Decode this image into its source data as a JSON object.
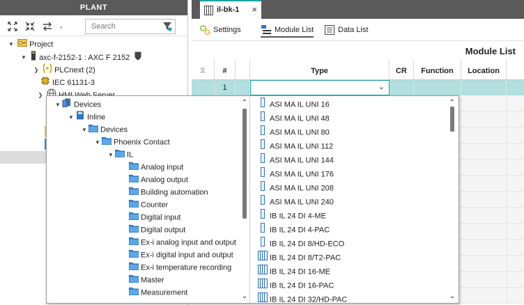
{
  "plant": {
    "header": "PLANT",
    "search_placeholder": "Search",
    "tree": [
      {
        "label": "Project"
      },
      {
        "label": "axc-f-2152-1 : AXC F 2152"
      },
      {
        "label": "PLCnext (2)"
      },
      {
        "label": "IEC 61131-3"
      },
      {
        "label": "HMI Web Server"
      }
    ]
  },
  "editor": {
    "doc_tab": "il-bk-1",
    "subtabs": [
      "Settings",
      "Module List",
      "Data List"
    ],
    "title": "Module List",
    "columns": [
      "#",
      "",
      "Type",
      "CR",
      "Function",
      "Location"
    ],
    "row1_number": "1"
  },
  "popup": {
    "tree": [
      {
        "label": "Devices"
      },
      {
        "label": "Inline"
      },
      {
        "label": "Devices"
      },
      {
        "label": "Phoenix Contact"
      },
      {
        "label": "IL"
      },
      {
        "label": "Analog input"
      },
      {
        "label": "Analog output"
      },
      {
        "label": "Building automation"
      },
      {
        "label": "Counter"
      },
      {
        "label": "Digital input"
      },
      {
        "label": "Digital output"
      },
      {
        "label": "Ex-i analog input and output"
      },
      {
        "label": "Ex-i digital input and output"
      },
      {
        "label": "Ex-i temperature recording"
      },
      {
        "label": "Master"
      },
      {
        "label": "Measurement"
      }
    ],
    "modules": [
      {
        "label": "ASI MA IL UNI 16",
        "icon": "single"
      },
      {
        "label": "ASI MA IL UNI 48",
        "icon": "single"
      },
      {
        "label": "ASI MA IL UNI 80",
        "icon": "single"
      },
      {
        "label": "ASI MA IL UNI 112",
        "icon": "single"
      },
      {
        "label": "ASI MA IL UNI 144",
        "icon": "single"
      },
      {
        "label": "ASI MA IL UNI 176",
        "icon": "single"
      },
      {
        "label": "ASI MA IL UNI 208",
        "icon": "single"
      },
      {
        "label": "ASI MA IL UNI 240",
        "icon": "single"
      },
      {
        "label": "IB IL 24 DI 4-ME",
        "icon": "single"
      },
      {
        "label": "IB IL 24 DI 4-PAC",
        "icon": "single"
      },
      {
        "label": "IB IL 24 DI 8/HD-ECO",
        "icon": "single"
      },
      {
        "label": "IB IL 24 DI 8/T2-PAC",
        "icon": "multi"
      },
      {
        "label": "IB IL 24 DI 16-ME",
        "icon": "multi"
      },
      {
        "label": "IB IL 24 DI 16-PAC",
        "icon": "multi"
      },
      {
        "label": "IB IL 24 DI 32/HD-PAC",
        "icon": "multi"
      }
    ]
  },
  "colors": {
    "accent": "#16a5a5",
    "selected_row": "#b2dfdf",
    "header_bar": "#5a5a5a",
    "folder": "#3b8fd9"
  }
}
